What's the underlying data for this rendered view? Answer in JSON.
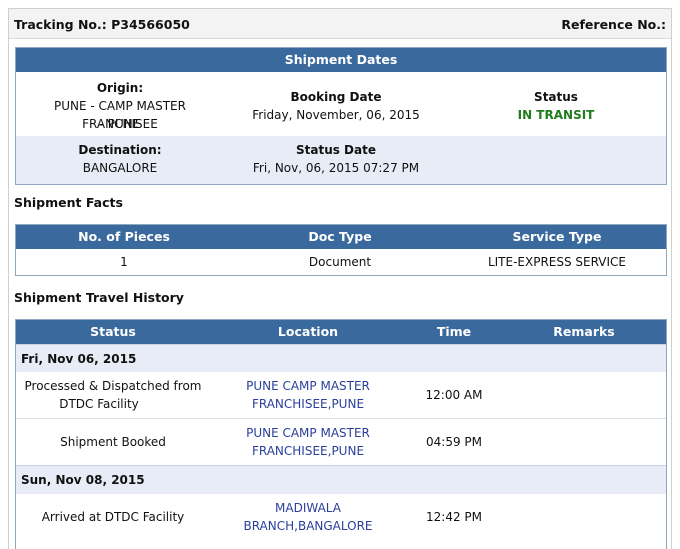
{
  "header": {
    "tracking_label": "Tracking No.: P34566050",
    "reference_label": "Reference No.:"
  },
  "shipment_dates": {
    "title": "Shipment Dates",
    "origin_label": "Origin:",
    "origin_line1": "PUNE - CAMP MASTER FRANCHISEE",
    "origin_line2": "- PUNE",
    "booking_label": "Booking Date",
    "booking_value": "Friday, November, 06, 2015",
    "status_label": "Status",
    "status_value": "IN TRANSIT",
    "destination_label": "Destination:",
    "destination_value": "BANGALORE",
    "status_date_label": "Status Date",
    "status_date_value": "Fri, Nov, 06, 2015 07:27 PM"
  },
  "shipment_facts": {
    "title": "Shipment Facts",
    "columns": [
      "No. of Pieces",
      "Doc Type",
      "Service Type"
    ],
    "values": [
      "1",
      "Document",
      "LITE-EXPRESS SERVICE"
    ]
  },
  "travel_history": {
    "title": "Shipment Travel History",
    "columns": [
      "Status",
      "Location",
      "Time",
      "Remarks"
    ],
    "groups": [
      {
        "date": "Fri, Nov 06, 2015",
        "rows": [
          {
            "status_line1": "Processed & Dispatched from",
            "status_line2": "DTDC Facility",
            "loc_line1": "PUNE CAMP MASTER",
            "loc_line2": "FRANCHISEE,PUNE",
            "time": "12:00 AM"
          },
          {
            "status_line1": "Shipment Booked",
            "status_line2": "",
            "loc_line1": "PUNE CAMP MASTER",
            "loc_line2": "FRANCHISEE,PUNE",
            "time": "04:59 PM"
          }
        ]
      },
      {
        "date": "Sun, Nov 08, 2015",
        "rows": [
          {
            "status_line1": "Arrived at DTDC Facility",
            "status_line2": "",
            "loc_line1": "MADIWALA",
            "loc_line2": "BRANCH,BANGALORE",
            "time": "12:42 PM"
          }
        ]
      }
    ]
  }
}
